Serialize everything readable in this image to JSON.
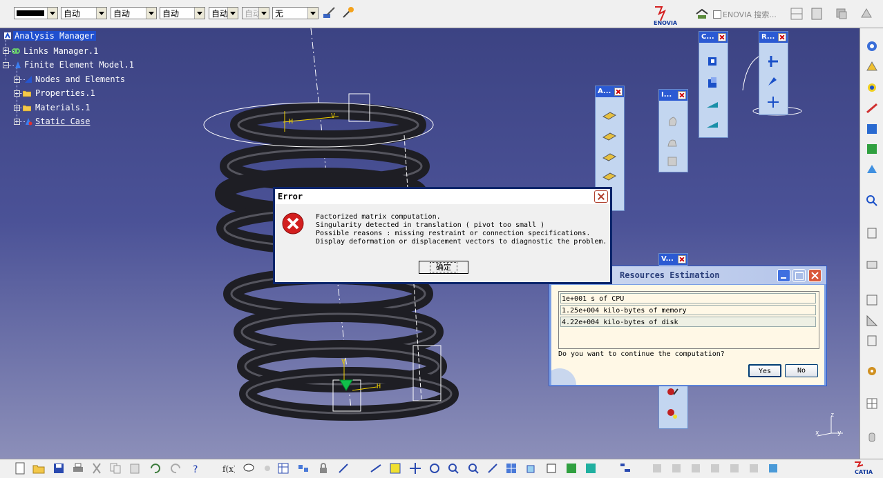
{
  "toolbar": {
    "color_value": "",
    "combo1": "自动",
    "combo2": "自动",
    "combo3": "自动",
    "combo4": "自动",
    "combo5": "自动",
    "combo6": "无",
    "enovia_logo": "ENOVIA",
    "enovia_search": "ENOVIA 搜索..."
  },
  "tree": {
    "items": [
      {
        "label": "Analysis Manager"
      },
      {
        "label": "Links Manager.1"
      },
      {
        "label": "Finite Element Model.1"
      },
      {
        "label": "Nodes and Elements"
      },
      {
        "label": "Properties.1"
      },
      {
        "label": "Materials.1"
      },
      {
        "label": "Static Case"
      }
    ]
  },
  "floating_toolbars": [
    {
      "title": "C..."
    },
    {
      "title": "R..."
    },
    {
      "title": "A..."
    },
    {
      "title": "I..."
    },
    {
      "title": "V..."
    }
  ],
  "error_dialog": {
    "title": "Error",
    "lines": [
      "Factorized matrix computation.",
      "Singularity detected in translation ( pivot too small )",
      "Possible reasons : missing restraint or connection specifications.",
      "Display deformation or displacement vectors to diagnostic the problem."
    ],
    "ok_label": "确定"
  },
  "resources_dialog": {
    "title": "Resources Estimation",
    "rows": [
      "1e+001 s of CPU",
      "1.25e+004 kilo-bytes of memory",
      "4.22e+004 kilo-bytes of disk"
    ],
    "question": "Do you want to continue the computation?",
    "yes_label": "Yes",
    "no_label": "No"
  },
  "viewport_labels": {
    "h_top": "H",
    "v_top": "V",
    "h_bottom": "H",
    "v_bottom": "V"
  },
  "compass": {
    "x": "x",
    "y": "y",
    "z": "z"
  },
  "catia_logo": "CATIA",
  "colors": {
    "viewport_top": "#3c4383",
    "viewport_bottom": "#8c8fb9",
    "selection": "#1f4fcf",
    "error_title_bg": "#ffffff",
    "spring": "#2a2a30"
  }
}
